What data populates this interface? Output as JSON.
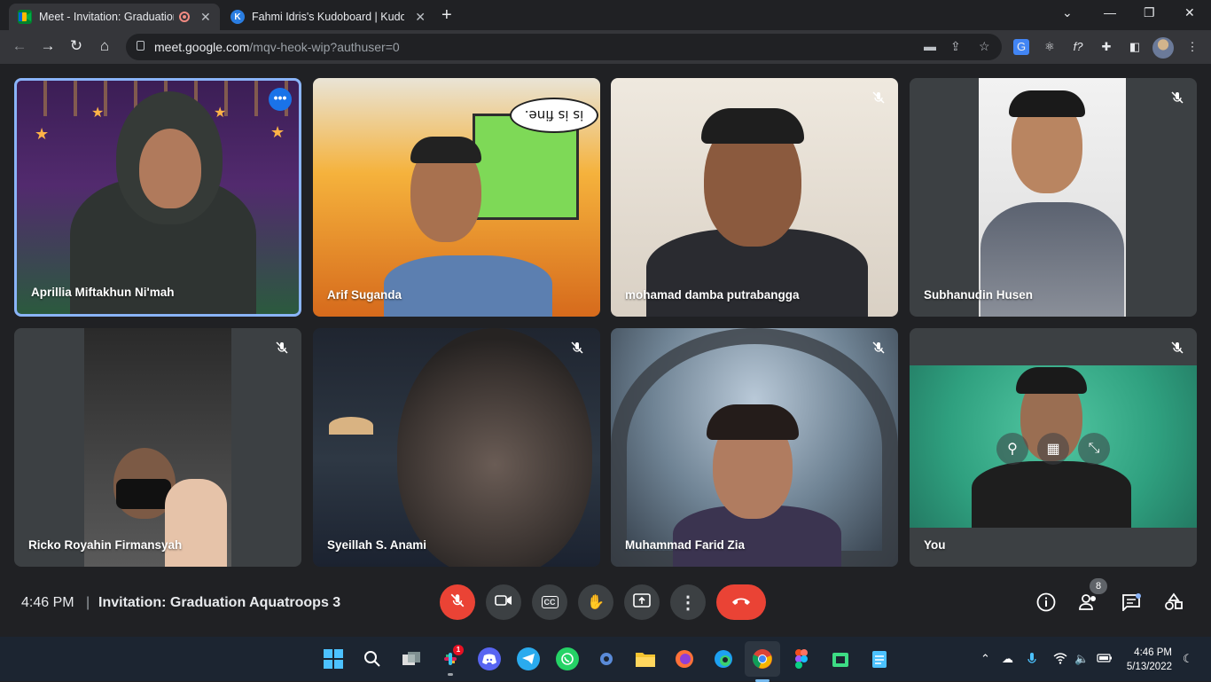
{
  "browser": {
    "tabs": [
      {
        "title": "Meet - Invitation: Graduation",
        "favicon": "meet-icon",
        "recording": true,
        "active": true
      },
      {
        "title": "Fahmi Idris's Kudoboard | Kudob",
        "favicon": "kudoboard-icon",
        "favicon_letter": "K",
        "active": false
      }
    ],
    "url": {
      "host": "meet.google.com",
      "path": "/mqv-heok-wip?authuser=0"
    }
  },
  "participants": [
    {
      "name": "Aprillia Miftakhun Ni'mah",
      "speaking": true,
      "muted": false
    },
    {
      "name": "Arif Suganda",
      "speaking": false,
      "muted": false
    },
    {
      "name": "mohamad damba putrabangga",
      "speaking": false,
      "muted": true
    },
    {
      "name": "Subhanudin Husen",
      "speaking": false,
      "muted": true
    },
    {
      "name": "Ricko Royahin Firmansyah",
      "speaking": false,
      "muted": true
    },
    {
      "name": "Syeillah S. Anami",
      "speaking": false,
      "muted": true
    },
    {
      "name": "Muhammad Farid Zia",
      "speaking": false,
      "muted": true
    },
    {
      "name": "You",
      "speaking": false,
      "muted": true
    }
  ],
  "tile_texts": {
    "comic_bubble": "is is fine."
  },
  "meeting": {
    "time": "4:46 PM",
    "separator": "|",
    "title": "Invitation: Graduation Aquatroops 3",
    "people_count": "8"
  },
  "taskbar": {
    "slack_badge": "1",
    "time": "4:46 PM",
    "date": "5/13/2022"
  },
  "colors": {
    "accent": "#8ab4f8",
    "end_call": "#ea4335",
    "tile_bg": "#3c4043",
    "page_bg": "#202124"
  }
}
